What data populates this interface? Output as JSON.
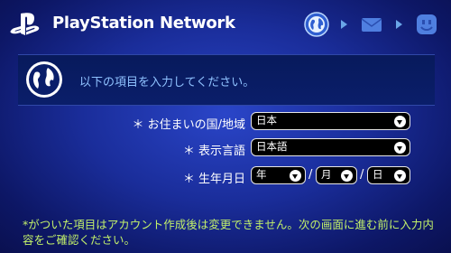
{
  "header": {
    "brand": "PlayStation Network",
    "steps": [
      {
        "icon": "globe-icon",
        "state": "active"
      },
      {
        "icon": "envelope-icon",
        "state": "inactive"
      },
      {
        "icon": "smiley-icon",
        "state": "inactive"
      }
    ]
  },
  "instruction": {
    "text": "以下の項目を入力してください。"
  },
  "form": {
    "country": {
      "label": "＊ お住まいの国/地域",
      "value": "日本"
    },
    "language": {
      "label": "＊ 表示言語",
      "value": "日本語"
    },
    "birthdate": {
      "label": "＊ 生年月日",
      "year": "年",
      "month": "月",
      "day": "日",
      "separator": "/"
    }
  },
  "footer": {
    "note": "*がついた項目はアカウント作成後は変更できません。次の画面に進む前に入力内容をご確認ください。"
  },
  "colors": {
    "accent_text": "#8fc2ff",
    "note_text": "#c2f06a",
    "background": "#1a2d9a"
  }
}
